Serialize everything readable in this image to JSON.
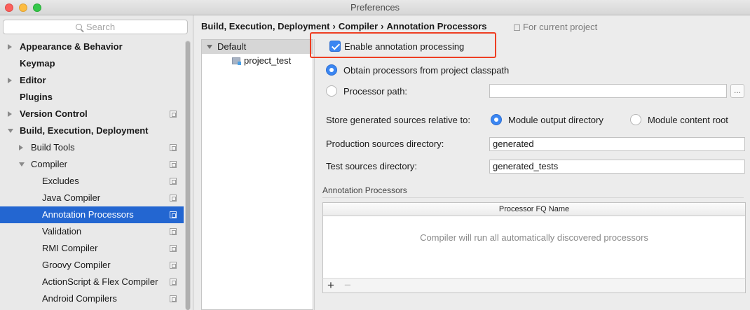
{
  "window": {
    "title": "Preferences",
    "traffic_lights": [
      "close",
      "minimize",
      "maximize"
    ]
  },
  "sidebar": {
    "search_placeholder": "Search",
    "items": [
      {
        "label": "Appearance & Behavior",
        "bold": true,
        "arrow": "right",
        "level": 0,
        "scope_icon": false
      },
      {
        "label": "Keymap",
        "bold": true,
        "arrow": "none",
        "level": 0,
        "scope_icon": false
      },
      {
        "label": "Editor",
        "bold": true,
        "arrow": "right",
        "level": 0,
        "scope_icon": false
      },
      {
        "label": "Plugins",
        "bold": true,
        "arrow": "none",
        "level": 0,
        "scope_icon": false
      },
      {
        "label": "Version Control",
        "bold": true,
        "arrow": "right",
        "level": 0,
        "scope_icon": true
      },
      {
        "label": "Build, Execution, Deployment",
        "bold": true,
        "arrow": "down",
        "level": 0,
        "scope_icon": false
      },
      {
        "label": "Build Tools",
        "bold": false,
        "arrow": "right",
        "level": 1,
        "scope_icon": true
      },
      {
        "label": "Compiler",
        "bold": false,
        "arrow": "down",
        "level": 1,
        "scope_icon": true
      },
      {
        "label": "Excludes",
        "bold": false,
        "arrow": "none",
        "level": 2,
        "scope_icon": true
      },
      {
        "label": "Java Compiler",
        "bold": false,
        "arrow": "none",
        "level": 2,
        "scope_icon": true
      },
      {
        "label": "Annotation Processors",
        "bold": false,
        "arrow": "none",
        "level": 2,
        "scope_icon": true,
        "selected": true
      },
      {
        "label": "Validation",
        "bold": false,
        "arrow": "none",
        "level": 2,
        "scope_icon": true
      },
      {
        "label": "RMI Compiler",
        "bold": false,
        "arrow": "none",
        "level": 2,
        "scope_icon": true
      },
      {
        "label": "Groovy Compiler",
        "bold": false,
        "arrow": "none",
        "level": 2,
        "scope_icon": true
      },
      {
        "label": "ActionScript & Flex Compiler",
        "bold": false,
        "arrow": "none",
        "level": 2,
        "scope_icon": true
      },
      {
        "label": "Android Compilers",
        "bold": false,
        "arrow": "none",
        "level": 2,
        "scope_icon": true
      }
    ]
  },
  "breadcrumb": {
    "parts": [
      "Build, Execution, Deployment",
      "Compiler",
      "Annotation Processors"
    ],
    "separator": "›",
    "scope_label": "For current project"
  },
  "profiles": {
    "default_label": "Default",
    "module_label": "project_test"
  },
  "settings": {
    "enable_label": "Enable annotation processing",
    "enable_checked": true,
    "obtain_label": "Obtain processors from project classpath",
    "obtain_selected": true,
    "processor_path_label": "Processor path:",
    "processor_path_value": "",
    "browse_label": "...",
    "store_label": "Store generated sources relative to:",
    "module_output_label": "Module output directory",
    "module_output_selected": true,
    "module_content_label": "Module content root",
    "production_label": "Production sources directory:",
    "production_value": "generated",
    "test_label": "Test sources directory:",
    "test_value": "generated_tests"
  },
  "annotation_table": {
    "section_title": "Annotation Processors",
    "column_header": "Processor FQ Name",
    "empty_text": "Compiler will run all automatically discovered processors",
    "add_label": "+",
    "remove_label": "−"
  },
  "colors": {
    "selection": "#2366d1",
    "accent": "#3b86f2",
    "highlight_box": "#ee3e22"
  }
}
